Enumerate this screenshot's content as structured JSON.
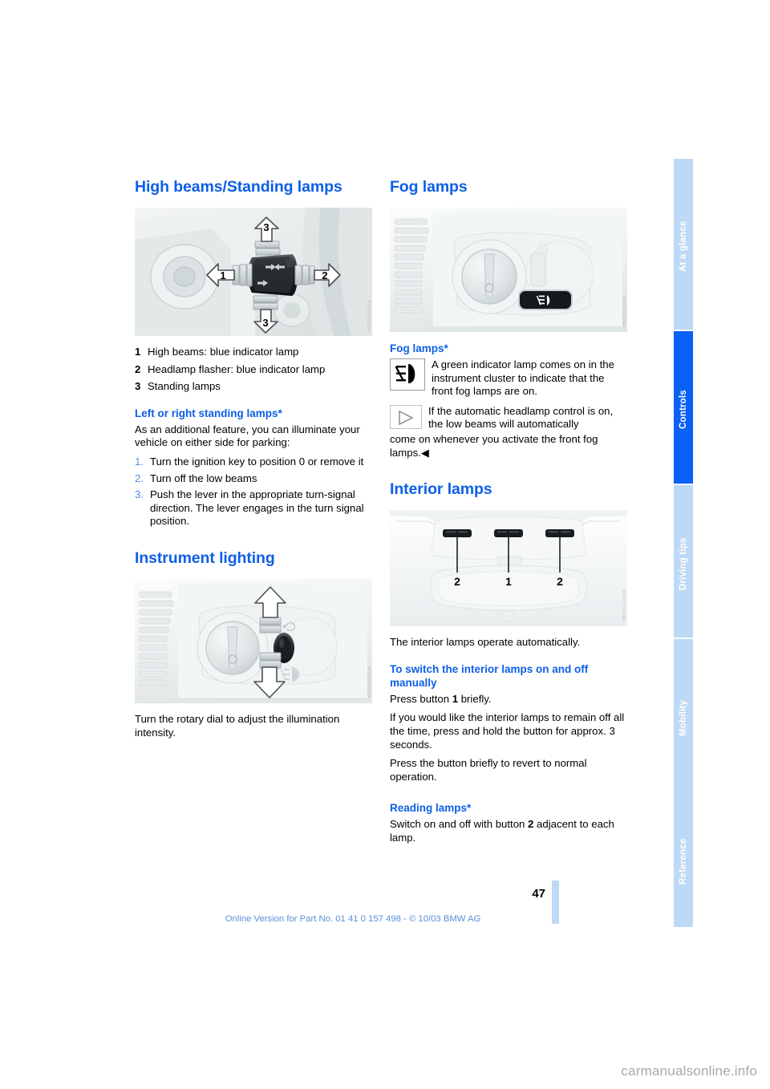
{
  "document": {
    "page_number": "47",
    "footer_note": "Online Version for Part No. 01 41 0 157 498 - © 10/03 BMW AG",
    "watermark": "carmanualsonline.info"
  },
  "colors": {
    "heading_blue": "#0d5fe8",
    "tab_active": "#0b60f5",
    "tab_inactive": "#bed9f5",
    "footer_text": "#5a8ede",
    "list_marker": "#4d8fe0"
  },
  "sidebar": {
    "tabs": [
      {
        "label": "At a glance",
        "active": false
      },
      {
        "label": "Controls",
        "active": true
      },
      {
        "label": "Driving tips",
        "active": false
      },
      {
        "label": "Mobility",
        "active": false
      },
      {
        "label": "Reference",
        "active": false
      }
    ]
  },
  "left_column": {
    "section1": {
      "title": "High beams/Standing lamps",
      "figure_code": "MY01T62CMA",
      "legend": [
        {
          "num": "1",
          "text": "High beams: blue indicator lamp"
        },
        {
          "num": "2",
          "text": "Headlamp flasher: blue indicator lamp"
        },
        {
          "num": "3",
          "text": "Standing lamps"
        }
      ],
      "subheading": "Left or right standing lamps*",
      "intro": "As an additional feature, you can illuminate your vehicle on either side for parking:",
      "steps": [
        {
          "marker": "1.",
          "text": "Turn the ignition key to position 0 or remove it"
        },
        {
          "marker": "2.",
          "text": "Turn off the low beams"
        },
        {
          "marker": "3.",
          "text": "Push the lever in the appropriate turn-signal direction. The lever engages in the turn signal position."
        }
      ]
    },
    "section2": {
      "title": "Instrument lighting",
      "figure_code": "MY01T64CMA",
      "body": "Turn the rotary dial to adjust the illumination intensity."
    }
  },
  "right_column": {
    "section1": {
      "title": "Fog lamps",
      "figure_code": "MY01T66CMA",
      "subheading": "Fog lamps*",
      "note_icon_name": "fog-lamp-indicator-icon",
      "note_text": "A green indicator lamp comes on in the instrument cluster to indicate that the front fog lamps are on.",
      "tip_icon_name": "triangle-pointer-icon",
      "tip_text_indented": "If the automatic headlamp control is on, the low beams will automatically",
      "tip_text_rest": "come on whenever you activate the front fog lamps.◀"
    },
    "section2": {
      "title": "Interior lamps",
      "figure_code": "MY01T72CMA",
      "body": "The interior lamps operate automatically.",
      "subheading1": "To switch the interior lamps on and off manually",
      "para1_a": "Press button ",
      "para1_b": "1",
      "para1_c": " briefly.",
      "para2": "If you would like the interior lamps to remain off all the time, press and hold the button for approx. 3 seconds.",
      "para3": "Press the button briefly to revert to normal operation.",
      "subheading2": "Reading lamps*",
      "para4_a": "Switch on and off with button ",
      "para4_b": "2",
      "para4_c": " adjacent to each lamp."
    }
  }
}
